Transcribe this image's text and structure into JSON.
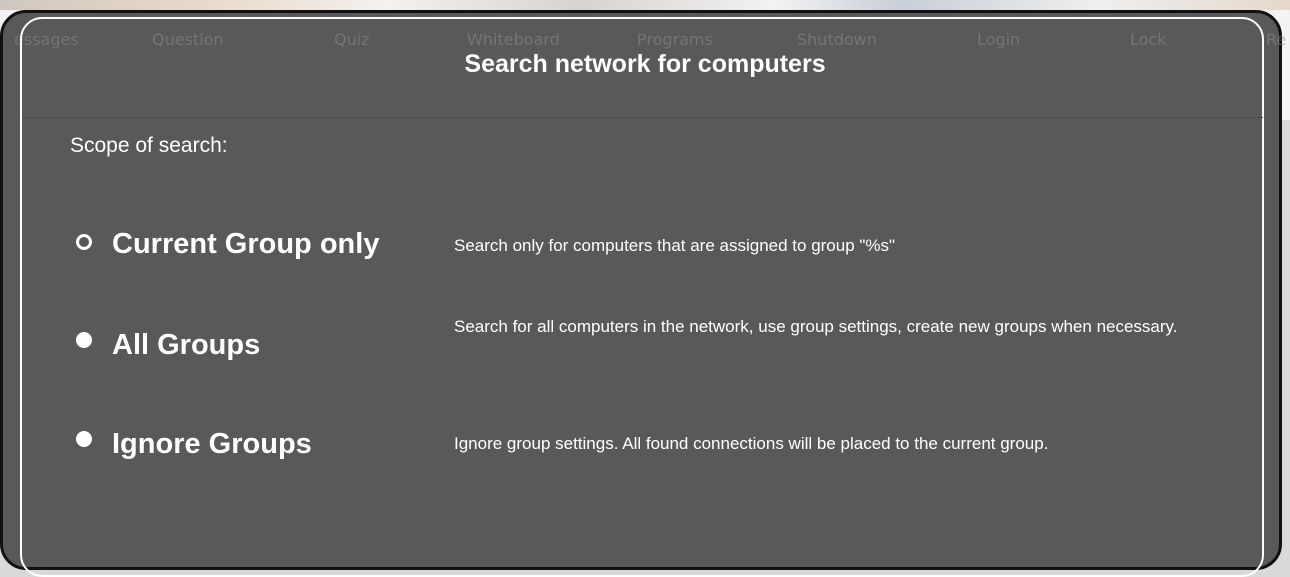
{
  "background_toolbar": {
    "tabs": [
      "essages",
      "Question",
      "Quiz",
      "Whiteboard",
      "Programs",
      "Shutdown",
      "Login",
      "Lock",
      "Re"
    ]
  },
  "dialog": {
    "title": "Search network for computers",
    "scope_label": "Scope of search:",
    "options": [
      {
        "label": "Current Group only",
        "description": "Search only for computers that are assigned to group \"%s\"",
        "selected": true
      },
      {
        "label": "All Groups",
        "description": "Search for all computers in the network, use group settings, create new groups when necessary.",
        "selected": false
      },
      {
        "label": "Ignore Groups",
        "description": "Ignore group settings. All found connections will be placed to the current group.",
        "selected": false
      }
    ]
  }
}
